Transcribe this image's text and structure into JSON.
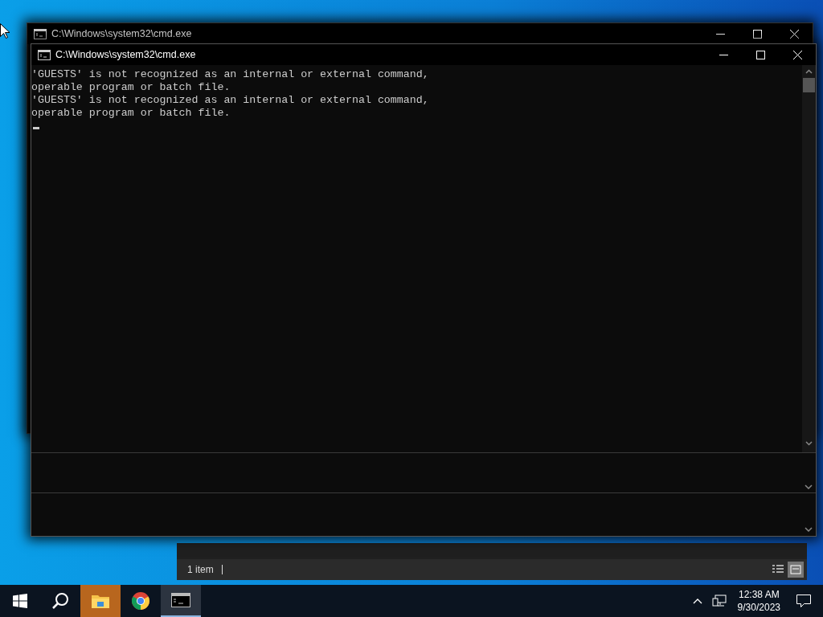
{
  "windows": [
    {
      "title": "C:\\Windows\\system32\\cmd.exe",
      "active": false
    },
    {
      "title": "C:\\Windows\\system32\\cmd.exe",
      "active": true,
      "console_lines": [
        "'GUESTS' is not recognized as an internal or external command,",
        "operable program or batch file.",
        "'GUESTS' is not recognized as an internal or external command,",
        "operable program or batch file."
      ]
    }
  ],
  "explorer": {
    "status": "1 item"
  },
  "taskbar": {
    "apps": [
      {
        "kind": "explorer",
        "highlighted": true,
        "selected": false
      },
      {
        "kind": "chrome",
        "highlighted": false,
        "selected": false
      },
      {
        "kind": "cmd",
        "highlighted": false,
        "selected": true
      }
    ],
    "time": "12:38 AM",
    "date": "9/30/2023"
  }
}
